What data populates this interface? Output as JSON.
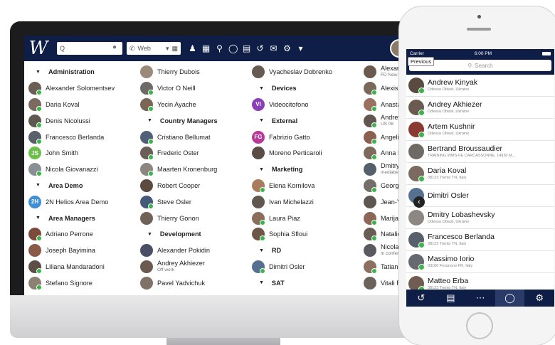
{
  "desktop": {
    "logo": "W",
    "search": {
      "placeholder": "Q"
    },
    "web_select": {
      "value": "Web"
    },
    "user_name": "Er",
    "columns": [
      [
        {
          "type": "group",
          "label": "Administration"
        },
        {
          "type": "contact",
          "name": "Alexander Solomentsev",
          "color": "#6b5e55",
          "dot": true
        },
        {
          "type": "contact",
          "name": "Daria Koval",
          "color": "#7a6a5f",
          "dot": true
        },
        {
          "type": "contact",
          "name": "Denis Nicolussi",
          "color": "#5f5850",
          "dot": true
        },
        {
          "type": "contact",
          "name": "Francesco Berlanda",
          "color": "#58606b",
          "dot": true
        },
        {
          "type": "contact",
          "name": "John Smith",
          "initials": "JS",
          "color": "#6cc04a",
          "dot": false
        },
        {
          "type": "contact",
          "name": "Nicola Giovanazzi",
          "color": "#8a8f96",
          "dot": true
        },
        {
          "type": "group",
          "label": "Area Demo"
        },
        {
          "type": "contact",
          "name": "2N Helios Area Demo",
          "initials": "2H",
          "color": "#3f8fd8",
          "dot": false
        },
        {
          "type": "group",
          "label": "Area Managers"
        },
        {
          "type": "contact",
          "name": "Adriano Perrone",
          "color": "#7c4a3a",
          "dot": true
        },
        {
          "type": "contact",
          "name": "Joseph Bayimina",
          "color": "#8a5a48",
          "dot": false
        },
        {
          "type": "contact",
          "name": "Liliana Mandaradoni",
          "color": "#5d4e47",
          "dot": true
        },
        {
          "type": "contact",
          "name": "Stefano Signore",
          "color": "#8d8173",
          "dot": true
        }
      ],
      [
        {
          "type": "contact",
          "name": "Thierry Dubois",
          "color": "#9a8a7c",
          "dot": false
        },
        {
          "type": "contact",
          "name": "Victor O Neill",
          "color": "#6f6a66",
          "dot": true
        },
        {
          "type": "contact",
          "name": "Yecin Ayache",
          "color": "#7b6554",
          "dot": true
        },
        {
          "type": "group",
          "label": "Country Managers"
        },
        {
          "type": "contact",
          "name": "Cristiano Bellumat",
          "color": "#506078",
          "dot": true
        },
        {
          "type": "contact",
          "name": "Frederic Oster",
          "color": "#6a5e58",
          "dot": true
        },
        {
          "type": "contact",
          "name": "Maarten Kronenburg",
          "color": "#8c8580",
          "dot": true
        },
        {
          "type": "contact",
          "name": "Robert Cooper",
          "color": "#5b4a40",
          "dot": false
        },
        {
          "type": "contact",
          "name": "Steve Osler",
          "color": "#455a78",
          "dot": true
        },
        {
          "type": "contact",
          "name": "Thierry Gonon",
          "color": "#706257",
          "dot": false
        },
        {
          "type": "group",
          "label": "Development"
        },
        {
          "type": "contact",
          "name": "Alexander Pokidin",
          "color": "#4a4f66",
          "dot": false
        },
        {
          "type": "contact",
          "name": "Andrey Akhiezer",
          "sub": "Off work",
          "color": "#6a5a50",
          "dot": false
        },
        {
          "type": "contact",
          "name": "Pavel Yadvichuk",
          "color": "#7f7368",
          "dot": false
        }
      ],
      [
        {
          "type": "contact",
          "name": "Vyacheslav Dobrenko",
          "color": "#675a50",
          "dot": false
        },
        {
          "type": "group",
          "label": "Devices"
        },
        {
          "type": "contact",
          "name": "Videocitofono",
          "initials": "VI",
          "color": "#8a3fb8",
          "dot": false
        },
        {
          "type": "group",
          "label": "External"
        },
        {
          "type": "contact",
          "name": "Fabrizio Gatto",
          "initials": "FG",
          "color": "#b8399a",
          "dot": false
        },
        {
          "type": "contact",
          "name": "Moreno Perticaroli",
          "color": "#5a4d45",
          "dot": false
        },
        {
          "type": "group",
          "label": "Marketing"
        },
        {
          "type": "contact",
          "name": "Elena Kornilova",
          "color": "#a87c5c",
          "dot": true
        },
        {
          "type": "contact",
          "name": "Ivan Michelazzi",
          "color": "#5f5750",
          "dot": false
        },
        {
          "type": "contact",
          "name": "Laura Piaz",
          "color": "#8a6e5c",
          "dot": true
        },
        {
          "type": "contact",
          "name": "Sophia Sfloui",
          "color": "#6d5648",
          "dot": true
        },
        {
          "type": "group",
          "label": "RD"
        },
        {
          "type": "contact",
          "name": "Dimitri Osler",
          "color": "#557090",
          "dot": true
        },
        {
          "type": "group",
          "label": "SAT"
        }
      ],
      [
        {
          "type": "contact",
          "name": "Alexandr Si",
          "sub": "FD New + Shrink",
          "color": "#6c5a4e",
          "dot": false
        },
        {
          "type": "contact",
          "name": "Alexis Strat",
          "color": "#7a6858",
          "dot": true
        },
        {
          "type": "contact",
          "name": "Anastasia L",
          "color": "#9a7060",
          "dot": true
        },
        {
          "type": "contact",
          "name": "Andrew Vor",
          "sub": "US 08",
          "color": "#60564f",
          "dot": true
        },
        {
          "type": "contact",
          "name": "Angelika R",
          "color": "#8a6050",
          "dot": true
        },
        {
          "type": "contact",
          "name": "Anna Rado",
          "color": "#7d6a5d",
          "dot": true
        },
        {
          "type": "contact",
          "name": "Dmitry Kor",
          "sub": "mediaber TeleCtrl",
          "color": "#56606a",
          "dot": false
        },
        {
          "type": "contact",
          "name": "Georgij Gal",
          "color": "#747069",
          "dot": true
        },
        {
          "type": "contact",
          "name": "Jean-Yves",
          "color": "#5e5652",
          "dot": false
        },
        {
          "type": "contact",
          "name": "Marija Spoc",
          "color": "#8c6656",
          "dot": true
        },
        {
          "type": "contact",
          "name": "Natalie Ste",
          "color": "#6a5d54",
          "dot": true
        },
        {
          "type": "contact",
          "name": "Nicolae Ga",
          "sub": "In conference",
          "color": "#5a5a60",
          "dot": false
        },
        {
          "type": "contact",
          "name": "Tatiana Bla",
          "color": "#8d7060",
          "dot": true
        },
        {
          "type": "contact",
          "name": "Vitali Farb",
          "color": "#6b625b",
          "dot": false
        }
      ]
    ]
  },
  "phone": {
    "carrier": "Carrier",
    "time": "6:00 PM",
    "tooltip": "Previous",
    "search_placeholder": "Search",
    "contacts": [
      {
        "name": "Andrew Kinyak",
        "location": "Odessa Oblast, Ukraine",
        "color": "#5a4a40",
        "dot": true
      },
      {
        "name": "Andrey Akhiezer",
        "location": "Odessa Oblast, Ukraine",
        "color": "#6a5a50",
        "dot": true
      },
      {
        "name": "Artem Kushnir",
        "location": "Odessa Oblast, Ukraine",
        "color": "#8a3a30",
        "dot": true
      },
      {
        "name": "Bertrand Broussaudier",
        "location": "TRAINING WMS-FE CARCASSONNE, 14930 M...",
        "color": "#706a64",
        "dot": false
      },
      {
        "name": "Daria Koval",
        "location": "38123 Trento TN, Italy",
        "color": "#7a6a5f",
        "dot": true
      },
      {
        "name": "Dimitri Osler",
        "location": "",
        "color": "#557090",
        "dot": true
      },
      {
        "name": "Dmitry Lobashevsky",
        "location": "Odessa Oblast, Ukraine",
        "color": "#8c8782",
        "dot": false
      },
      {
        "name": "Francesco Berlanda",
        "location": "38123 Trento TN, Italy",
        "color": "#58606b",
        "dot": true
      },
      {
        "name": "Massimo Iorio",
        "location": "03100 Frosinone FR, Italy",
        "color": "#666a70",
        "dot": true
      },
      {
        "name": "Matteo Erba",
        "location": "38123 Trento TN, Italy",
        "color": "#705c52",
        "dot": true
      }
    ]
  },
  "colors": {
    "navy": "#0f1e46",
    "presence": "#39b54a"
  }
}
